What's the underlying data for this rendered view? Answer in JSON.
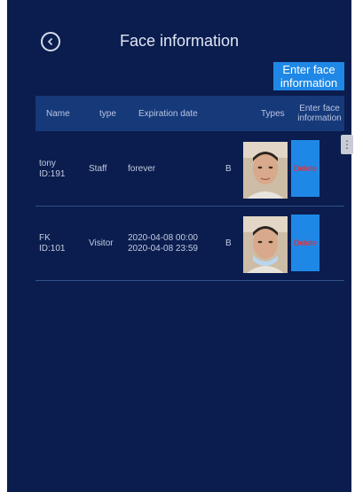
{
  "header": {
    "title": "Face information",
    "enter_face_button": "Enter face information"
  },
  "table": {
    "columns": [
      "Name",
      "type",
      "Expiration date",
      "Types",
      "Enter face information"
    ],
    "rows": [
      {
        "name": "tony",
        "id": "ID:191",
        "type": "Staff",
        "expiration_line1": "forever",
        "expiration_line2": "",
        "types": "B",
        "delete_label": "Delete"
      },
      {
        "name": "FK",
        "id": "ID:101",
        "type": "Visitor",
        "expiration_line1": "2020-04-08 00:00",
        "expiration_line2": "2020-04-08 23:59",
        "types": "B",
        "delete_label": "Delete"
      }
    ]
  },
  "icons": {
    "back": "back-arrow-icon",
    "scroll": "more-vertical-icon"
  },
  "colors": {
    "background": "#0a1d4e",
    "header_row": "#16397a",
    "accent": "#1f88e6",
    "delete_text": "#ff2323"
  }
}
